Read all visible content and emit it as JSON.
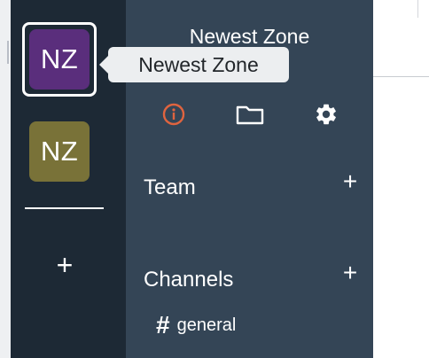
{
  "zones": [
    {
      "initials": "NZ",
      "color": "#5a2e7c"
    },
    {
      "initials": "NZ",
      "color": "#797238"
    }
  ],
  "add_zone_label": "+",
  "tooltip": {
    "text": "Newest Zone"
  },
  "panel": {
    "title": "Newest Zone",
    "icons": [
      "info-icon",
      "folder-icon",
      "gear-icon"
    ],
    "info_icon_color": "#e0643f",
    "sections": [
      {
        "title": "Team",
        "add": "+"
      },
      {
        "title": "Channels",
        "add": "+"
      }
    ],
    "channels": [
      {
        "hash": "#",
        "name": "general"
      }
    ]
  },
  "colors": {
    "rail_bg": "#1d2935",
    "panel_bg": "#344556",
    "tooltip_bg": "#eceef0"
  }
}
